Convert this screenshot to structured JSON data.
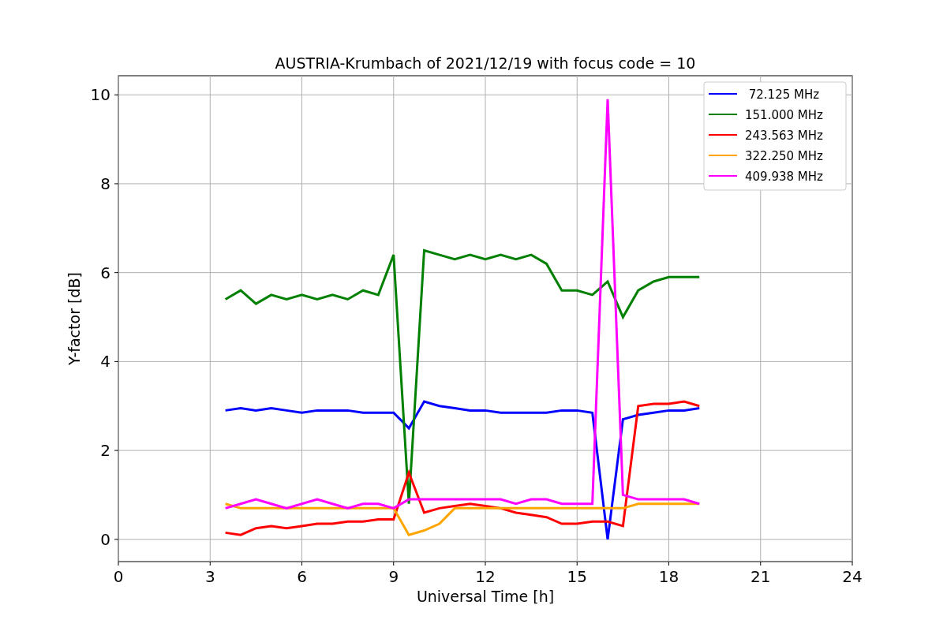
{
  "figure": {
    "chart_data": {
      "type": "line",
      "title": "AUSTRIA-Krumbach of 2021/12/19 with focus code = 10",
      "xlabel": "Universal Time [h]",
      "ylabel": "Y-factor [dB]",
      "x": [
        3.5,
        4,
        4.5,
        5,
        5.5,
        6,
        6.5,
        7,
        7.5,
        8,
        8.5,
        9,
        9.5,
        10,
        10.5,
        11,
        11.5,
        12,
        12.5,
        13,
        13.5,
        14,
        14.5,
        15,
        15.5,
        16,
        16.5,
        17,
        17.5,
        18,
        18.5,
        19
      ],
      "series": [
        {
          "name": " 72.125 MHz",
          "color": "#0000ff",
          "values": [
            2.9,
            2.95,
            2.9,
            2.95,
            2.9,
            2.85,
            2.9,
            2.9,
            2.9,
            2.85,
            2.85,
            2.85,
            2.5,
            3.1,
            3.0,
            2.95,
            2.9,
            2.9,
            2.85,
            2.85,
            2.85,
            2.85,
            2.9,
            2.9,
            2.85,
            0.0,
            2.7,
            2.8,
            2.85,
            2.9,
            2.9,
            2.95
          ]
        },
        {
          "name": "151.000 MHz",
          "color": "#008000",
          "values": [
            5.4,
            5.6,
            5.3,
            5.5,
            5.4,
            5.5,
            5.4,
            5.5,
            5.4,
            5.6,
            5.5,
            6.4,
            0.8,
            6.5,
            6.4,
            6.3,
            6.4,
            6.3,
            6.4,
            6.3,
            6.4,
            6.2,
            5.6,
            5.6,
            5.5,
            5.8,
            5.0,
            5.6,
            5.8,
            5.9,
            5.9,
            5.9
          ]
        },
        {
          "name": "243.563 MHz",
          "color": "#ff0000",
          "values": [
            0.15,
            0.1,
            0.25,
            0.3,
            0.25,
            0.3,
            0.35,
            0.35,
            0.4,
            0.4,
            0.45,
            0.45,
            1.5,
            0.6,
            0.7,
            0.75,
            0.8,
            0.75,
            0.7,
            0.6,
            0.55,
            0.5,
            0.35,
            0.35,
            0.4,
            0.4,
            0.3,
            3.0,
            3.05,
            3.05,
            3.1,
            3.0
          ]
        },
        {
          "name": "322.250 MHz",
          "color": "#ffa500",
          "values": [
            0.8,
            0.7,
            0.7,
            0.7,
            0.7,
            0.7,
            0.7,
            0.7,
            0.7,
            0.7,
            0.7,
            0.7,
            0.1,
            0.2,
            0.35,
            0.7,
            0.7,
            0.7,
            0.7,
            0.7,
            0.7,
            0.7,
            0.7,
            0.7,
            0.7,
            0.7,
            0.7,
            0.8,
            0.8,
            0.8,
            0.8,
            0.8
          ]
        },
        {
          "name": "409.938 MHz",
          "color": "#ff00ff",
          "values": [
            0.7,
            0.8,
            0.9,
            0.8,
            0.7,
            0.8,
            0.9,
            0.8,
            0.7,
            0.8,
            0.8,
            0.7,
            0.9,
            0.9,
            0.9,
            0.9,
            0.9,
            0.9,
            0.9,
            0.8,
            0.9,
            0.9,
            0.8,
            0.8,
            0.8,
            9.9,
            1.0,
            0.9,
            0.9,
            0.9,
            0.9,
            0.8
          ]
        }
      ],
      "grid": true,
      "legend": true,
      "xlim": [
        0,
        24
      ],
      "ylim": [
        -0.5,
        10.43
      ],
      "xticks": [
        0,
        3,
        6,
        9,
        12,
        15,
        18,
        21,
        24
      ],
      "yticks": [
        0,
        2,
        4,
        6,
        8,
        10
      ]
    }
  }
}
